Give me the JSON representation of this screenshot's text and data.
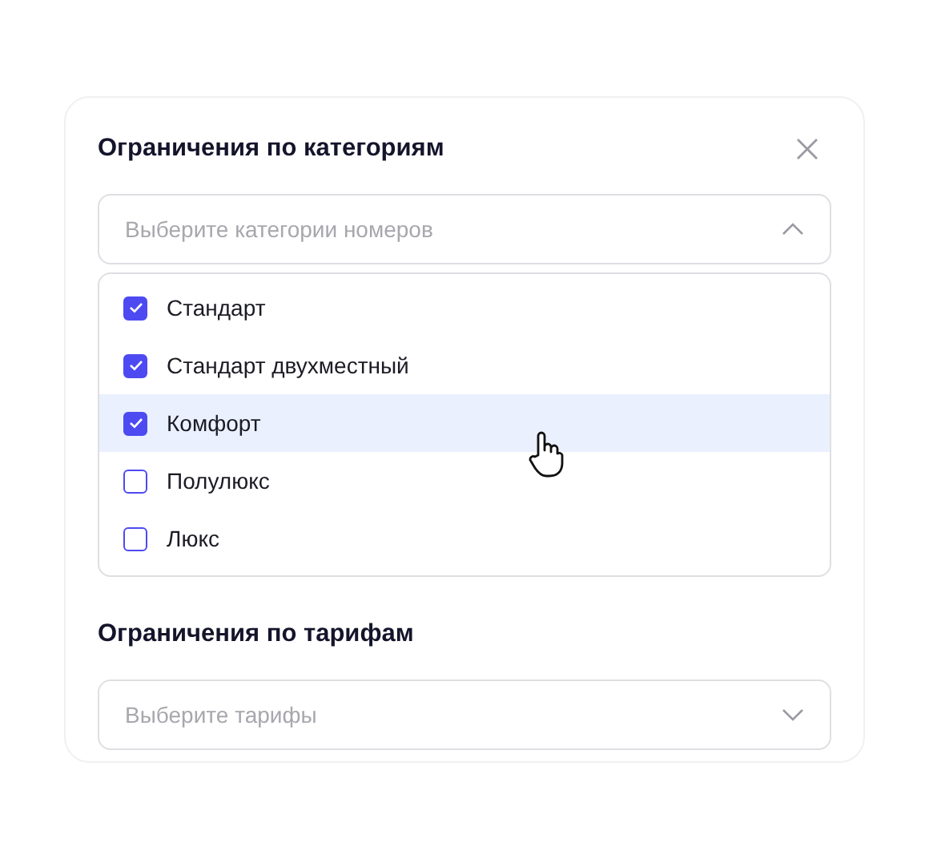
{
  "sections": [
    {
      "title": "Ограничения по категориям",
      "closable": true,
      "select": {
        "placeholder": "Выберите категории номеров",
        "expanded": true
      },
      "options": [
        {
          "label": "Стандарт",
          "checked": true,
          "hovered": false
        },
        {
          "label": "Стандарт двухместный",
          "checked": true,
          "hovered": false
        },
        {
          "label": "Комфорт",
          "checked": true,
          "hovered": true
        },
        {
          "label": "Полулюкс",
          "checked": false,
          "hovered": false
        },
        {
          "label": "Люкс",
          "checked": false,
          "hovered": false
        }
      ]
    },
    {
      "title": "Ограничения по тарифам",
      "closable": false,
      "select": {
        "placeholder": "Выберите тарифы",
        "expanded": false
      }
    }
  ]
}
